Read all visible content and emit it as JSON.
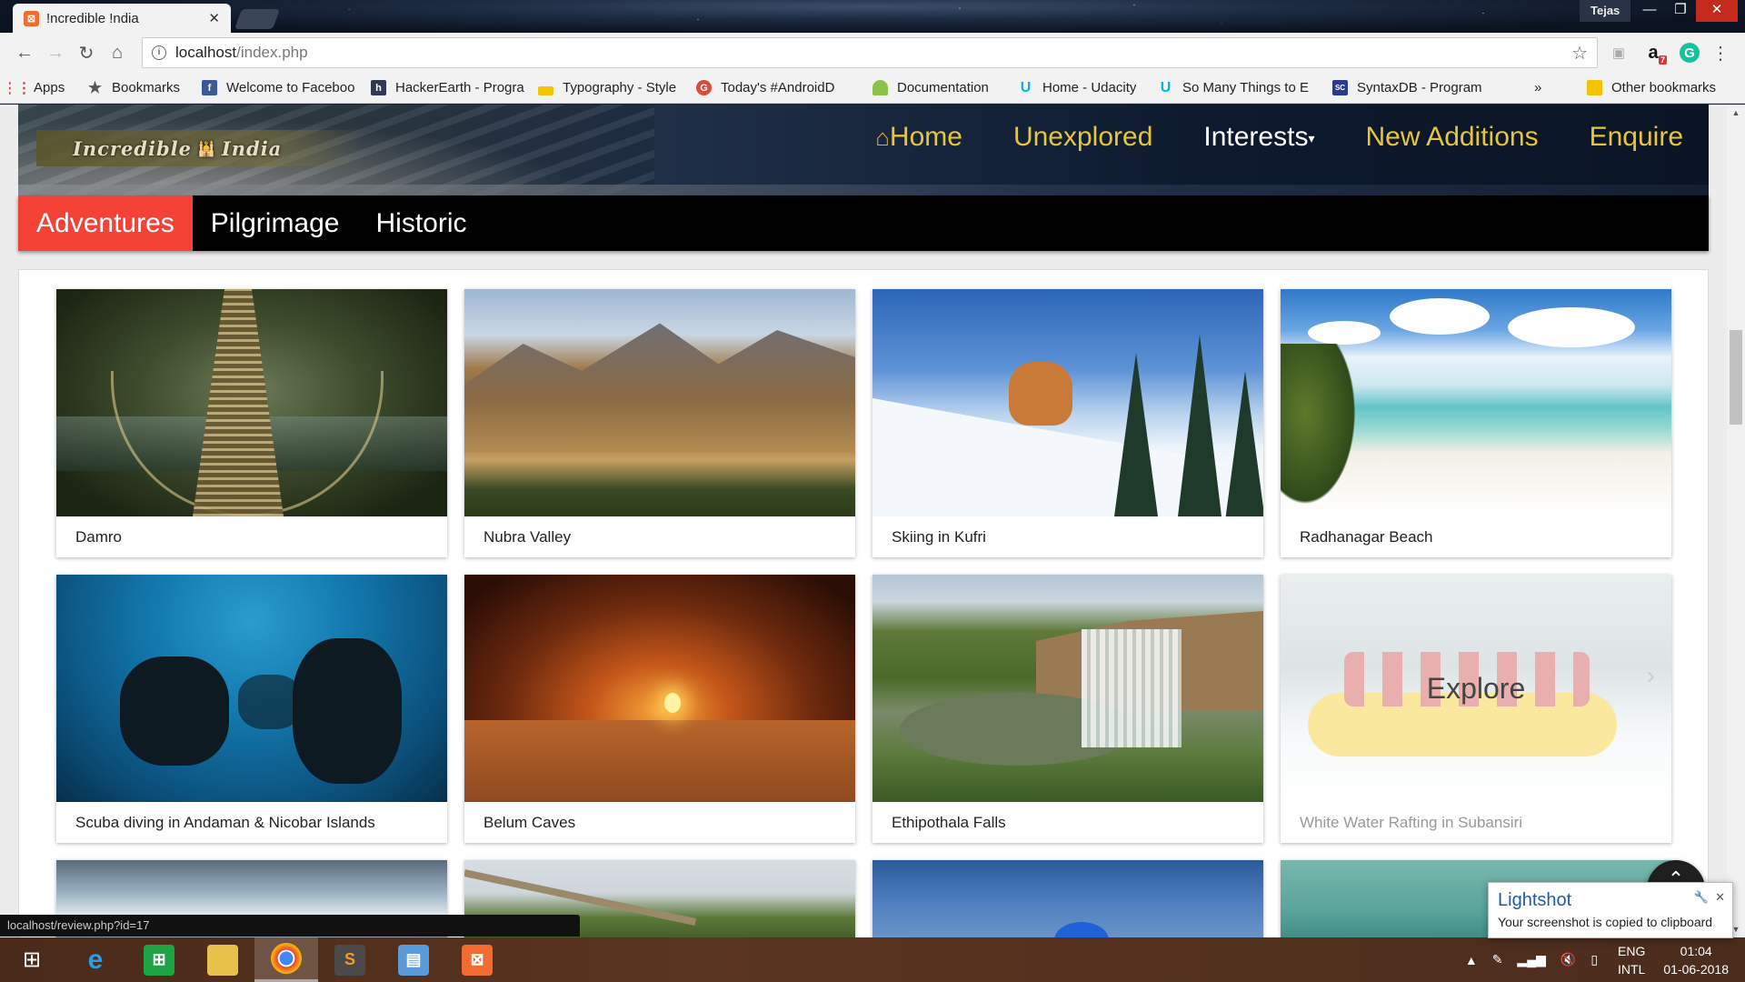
{
  "browser": {
    "tab_title": "!ncredible !ndia",
    "tab_favicon": "xampp-icon",
    "profile_name": "Tejas",
    "url_host": "localhost",
    "url_path": "/index.php",
    "extensions": {
      "amazon": "a",
      "amazon_badge": "7",
      "grammarly": "G"
    },
    "bookmarks": [
      {
        "label": "Apps",
        "icon": "apps-grid-icon"
      },
      {
        "label": "Bookmarks",
        "icon": "star-icon"
      },
      {
        "label": "Welcome to Faceboo",
        "icon": "facebook-icon"
      },
      {
        "label": "HackerEarth - Progra",
        "icon": "hackerearth-icon"
      },
      {
        "label": "Typography - Style",
        "icon": "folder-icon"
      },
      {
        "label": "Today's #AndroidD",
        "icon": "google-plus-icon"
      },
      {
        "label": "Documentation",
        "icon": "android-icon"
      },
      {
        "label": "Home - Udacity",
        "icon": "udacity-icon"
      },
      {
        "label": "So Many Things to E",
        "icon": "udacity-icon"
      },
      {
        "label": "SyntaxDB - Program",
        "icon": "syntaxdb-icon"
      }
    ],
    "bookmarks_overflow": "»",
    "other_bookmarks": "Other bookmarks"
  },
  "site": {
    "logo_left": "Incredible",
    "logo_right": "India",
    "nav": [
      {
        "label": "Home"
      },
      {
        "label": "Unexplored"
      },
      {
        "label": "Interests"
      },
      {
        "label": "New Additions"
      },
      {
        "label": "Enquire"
      }
    ],
    "subnav": [
      {
        "label": "Adventures"
      },
      {
        "label": "Pilgrimage"
      },
      {
        "label": "Historic"
      }
    ],
    "cards": [
      {
        "caption": "Damro"
      },
      {
        "caption": "Nubra Valley"
      },
      {
        "caption": "Skiing in Kufri"
      },
      {
        "caption": "Radhanagar Beach"
      },
      {
        "caption": "Scuba diving in Andaman & Nicobar Islands"
      },
      {
        "caption": "Belum Caves"
      },
      {
        "caption": "Ethipothala Falls"
      },
      {
        "caption": "White Water Rafting in Subansiri",
        "overlay": "Explore"
      }
    ]
  },
  "status_url": "localhost/review.php?id=17",
  "lightshot": {
    "title": "Lightshot",
    "message": "Your screenshot is copied to clipboard"
  },
  "taskbar": {
    "lang_line1": "ENG",
    "lang_line2": "INTL",
    "time": "01:04",
    "date": "01-06-2018"
  },
  "colors": {
    "nav_gold": "#e9c53a",
    "active_tab_red": "#f44336",
    "subnav_bg": "#000000"
  }
}
